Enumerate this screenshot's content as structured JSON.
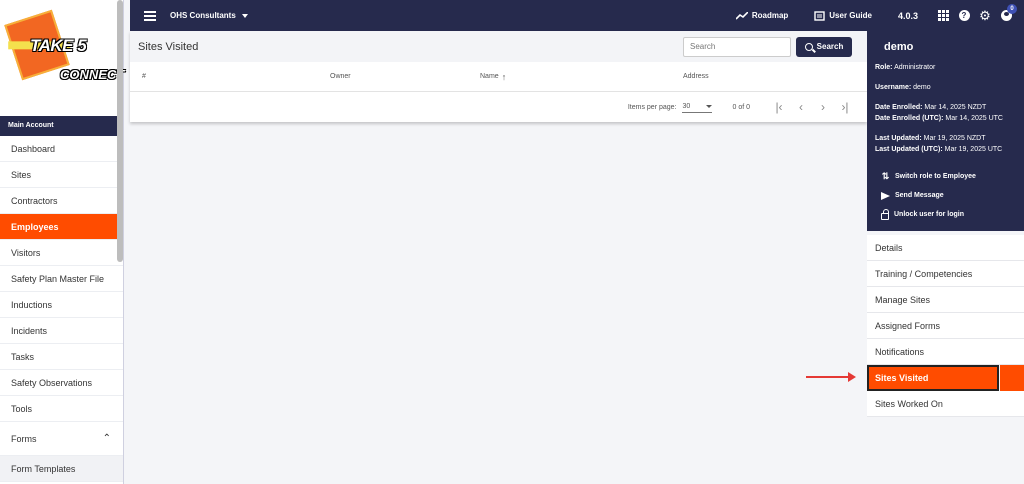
{
  "logo": {
    "line1": "TAKE 5",
    "line2": "CONNECT"
  },
  "sidebar": {
    "section": "Main Account",
    "items": [
      {
        "label": "Dashboard"
      },
      {
        "label": "Sites"
      },
      {
        "label": "Contractors"
      },
      {
        "label": "Employees",
        "active": true
      },
      {
        "label": "Visitors"
      },
      {
        "label": "Safety Plan Master File"
      },
      {
        "label": "Inductions"
      },
      {
        "label": "Incidents"
      },
      {
        "label": "Tasks"
      },
      {
        "label": "Safety Observations"
      },
      {
        "label": "Tools"
      },
      {
        "label": "Forms",
        "expanded": true
      },
      {
        "label": "Form Templates"
      }
    ]
  },
  "topbar": {
    "org": "OHS Consultants",
    "roadmap": "Roadmap",
    "guide": "User Guide",
    "version": "4.0.3",
    "notifications": "0"
  },
  "main": {
    "title": "Sites Visited",
    "search_placeholder": "Search",
    "search_button": "Search",
    "columns": [
      "#",
      "Owner",
      "Name",
      "Address"
    ],
    "items_per_page_label": "Items per page:",
    "items_per_page": "30",
    "range": "0 of 0"
  },
  "profile": {
    "name": "demo",
    "role_label": "Role:",
    "role": "Administrator",
    "username_label": "Username:",
    "username": "demo",
    "enrolled_label": "Date Enrolled:",
    "enrolled": "Mar 14, 2025 NZDT",
    "enrolled_utc_label": "Date Enrolled (UTC):",
    "enrolled_utc": "Mar 14, 2025 UTC",
    "updated_label": "Last Updated:",
    "updated": "Mar 19, 2025 NZDT",
    "updated_utc_label": "Last Updated (UTC):",
    "updated_utc": "Mar 19, 2025 UTC",
    "actions": [
      "Switch role to Employee",
      "Send Message",
      "Unlock user for login"
    ]
  },
  "tabs": [
    {
      "label": "Details"
    },
    {
      "label": "Training / Competencies"
    },
    {
      "label": "Manage Sites"
    },
    {
      "label": "Assigned Forms"
    },
    {
      "label": "Notifications"
    },
    {
      "label": "Sites Visited",
      "active": true
    },
    {
      "label": "Sites Worked On"
    }
  ],
  "colors": {
    "navy": "#262a4d",
    "accent": "#ff4c00"
  }
}
